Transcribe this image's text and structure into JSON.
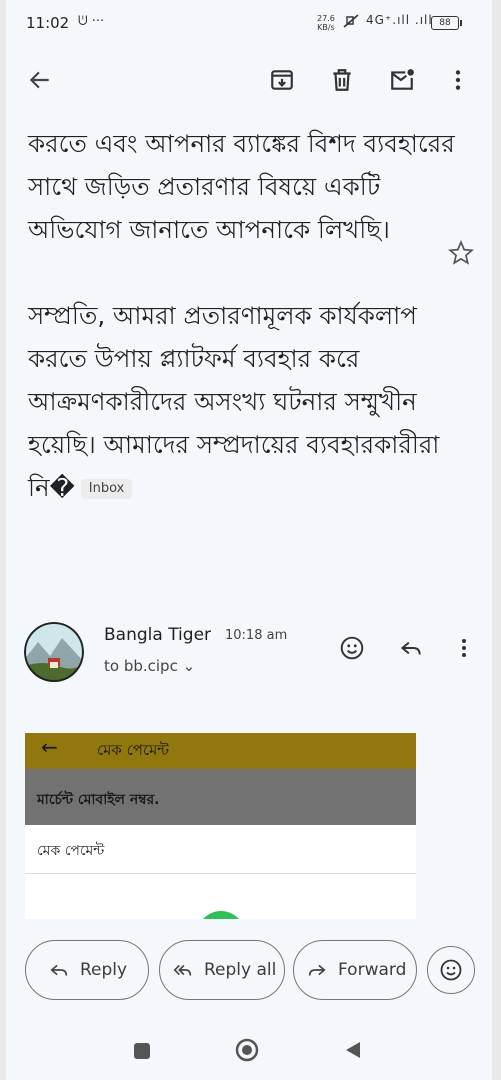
{
  "status_bar": {
    "time": "11:02",
    "notif_icons": "ᕫ ···",
    "net_speed_value": "27.6",
    "net_speed_unit": "KB/s",
    "signals": "4G⁺.ıll .ıll",
    "battery": "88"
  },
  "email": {
    "body_paragraphs": [
      "করতে এবং আপনার ব্যাঙ্কের বিশদ ব্যবহারের সাথে জড়িত প্রতারণার বিষয়ে একটি অভিযোগ জানাতে আপনাকে লিখছি।",
      "সম্প্রতি, আমরা প্রতারণামূলক কার্যকলাপ করতে উপায় প্ল্যাটফর্ম ব্যবহার করে আক্রমণকারীদের অসংখ্য ঘটনার সম্মুখীন হয়েছি। আমাদের সম্প্রদায়ের ব্যবহারকারীরা নি�"
    ],
    "label_badge": "Inbox"
  },
  "sender": {
    "name": "Bangla Tiger",
    "time": "10:18 am",
    "recipient": "to bb.cipc",
    "chevron": "⌄"
  },
  "embedded_image": {
    "header_title": "মেক পেমেন্ট",
    "back_arrow": "←",
    "field_label": "মার্চেন্ট মোবাইল নম্বর.",
    "card_text": "মেক পেমেন্ট"
  },
  "actions": {
    "reply": "Reply",
    "reply_all": "Reply all",
    "forward": "Forward"
  },
  "icons": {
    "toolbar": [
      "back-arrow-icon",
      "archive-icon",
      "delete-icon",
      "mark-unread-icon",
      "more-vert-icon"
    ],
    "row": [
      "emoji-icon",
      "reply-icon",
      "more-vert-icon"
    ]
  }
}
